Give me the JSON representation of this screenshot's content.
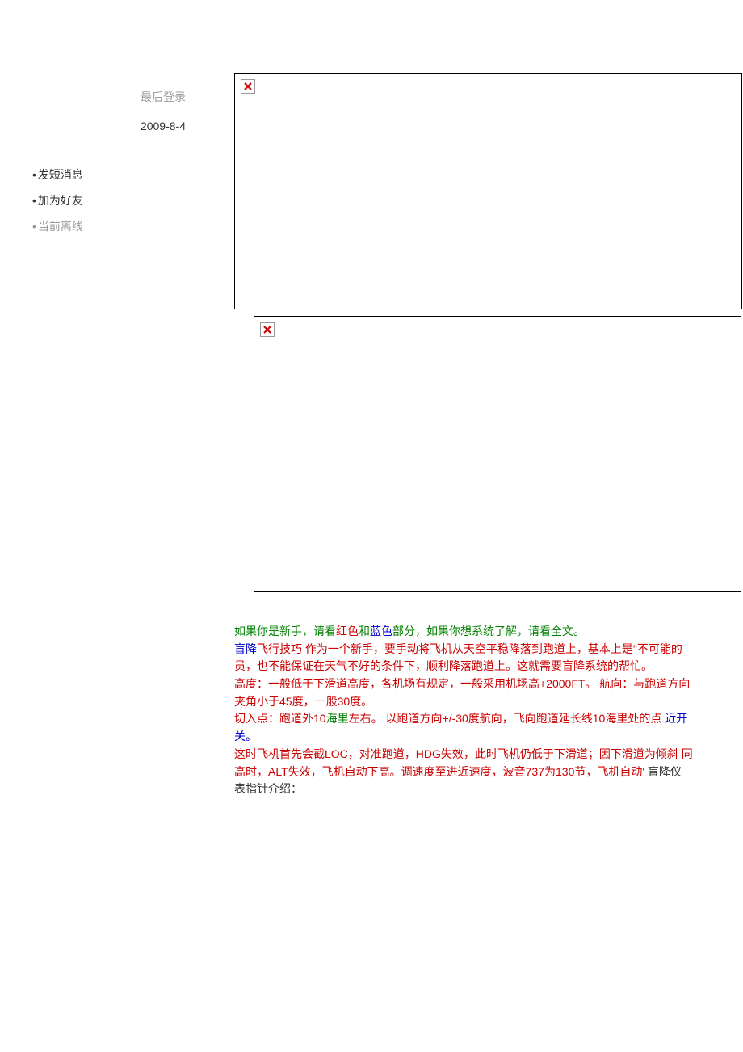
{
  "sidebar": {
    "lastLoginLabel": "最后登录",
    "lastLoginDate": "2009-8-4",
    "sendMessage": "发短消息",
    "addFriend": "加为好友",
    "status": "当前离线"
  },
  "post": {
    "t1a": "如果你是新手，请看",
    "t1b": "红色",
    "t1c": "和",
    "t1d": "蓝色",
    "t1e": "部分，如果你想系统了解，请看全文。",
    "t2a": "盲降",
    "t2b": "飞行技巧  作为一个新手，要手动将飞机从天空平稳降落到跑道上，基本上是\"不可能的",
    "t2c": "员，也不能保证在天气不好的条件下，顺利降落跑道上。这就需要盲降系统的帮忙。",
    "t3a": "高度：一般低于下滑道高度，各机场有规定，一般采用机场高+2000FT。  航向：与跑道方向",
    "t3b": "夹角小于45度，一般30度。",
    "t4a": "切入点：跑道外10",
    "t4b": "海里",
    "t4c": "左右。  以跑道方向+/-30度航向，飞向跑道延长线10海里处的点  ",
    "t4d": "近开",
    "t4e": "关。",
    "t5a": "这时飞机首先会截LOC，对准跑道，HDG失效，此时飞机仍低于下滑道；因下滑道为倾斜  同",
    "t5b": "高时，ALT失效，飞机自动下高。调速度至进近速度，波音737为130节，飞机自动'  ",
    "t5c": "盲降仪",
    "t5d": "表指针介绍："
  }
}
